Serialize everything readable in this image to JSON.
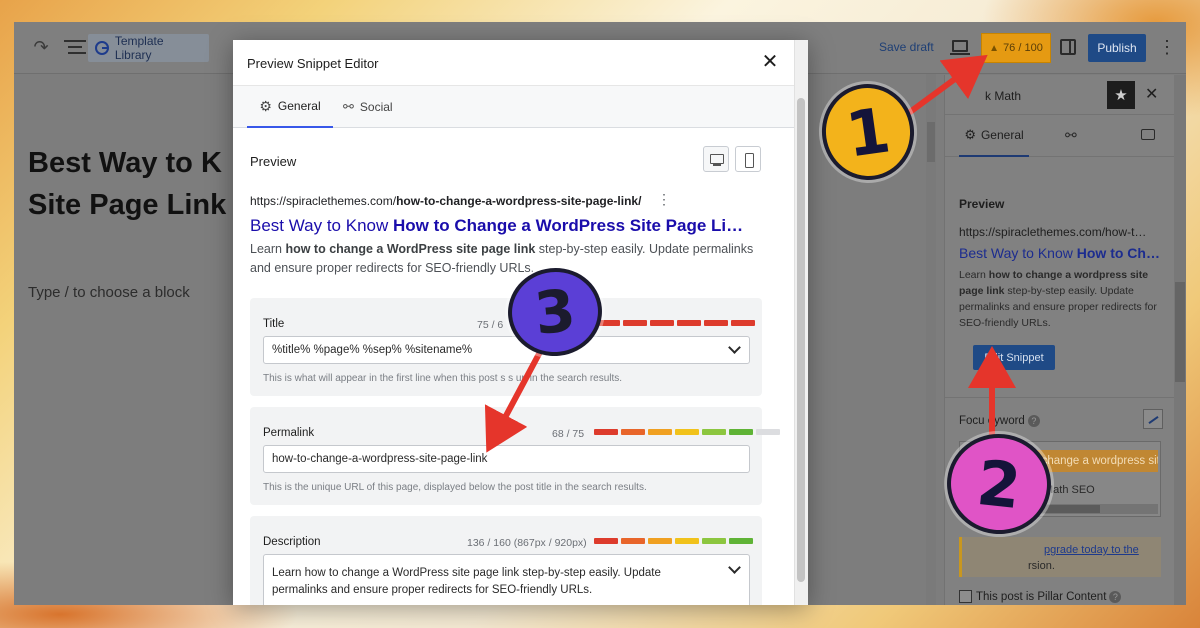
{
  "editor": {
    "template_library": "Template Library",
    "save_draft": "Save draft",
    "score": "76 / 100",
    "publish": "Publish",
    "post_title_lines": [
      "Best Way to K",
      "Site Page Link"
    ],
    "block_hint": "Type / to choose a block"
  },
  "sidebar": {
    "title": "k Math",
    "tab_general": "General",
    "preview_label": "Preview",
    "url": "https://spiraclethemes.com/how-t…",
    "serp_title_plain": "Best Way to Know ",
    "serp_title_bold": "How to Ch…",
    "serp_desc_html_parts": [
      "Learn ",
      "how to change a wordpress site page link",
      " step-by-step easily. Update permalinks and ensure proper redirects for SEO-friendly URLs."
    ],
    "edit_snippet": "Edit Snippet",
    "focus_label": "Focu  eyword",
    "keyword_chip": "o change a wordpress site",
    "keyword_sub": "Math SEO",
    "upgrade_link": "pgrade today to the",
    "upgrade_tail": "rsion.",
    "pillar": "This post is Pillar Content"
  },
  "modal": {
    "title": "Preview Snippet Editor",
    "tabs": {
      "general": "General",
      "social": "Social"
    },
    "preview_label": "Preview",
    "serp": {
      "url_base": "https://spiraclethemes.com/",
      "url_slug": "how-to-change-a-wordpress-site-page-link/",
      "title_plain": "Best Way to Know ",
      "title_bold": "How to Change a WordPress Site Page Li…",
      "desc_lead": "Learn ",
      "desc_bold": "how to change a WordPress site page link",
      "desc_tail": " step-by-step easily. Update permalinks and ensure proper redirects for SEO-friendly URLs."
    },
    "fields": {
      "title": {
        "label": "Title",
        "count": "75 / 6",
        "value": "%title% %page% %sep% %sitename%",
        "help": "This is what will appear in the first line when this post s   s up in the search results."
      },
      "permalink": {
        "label": "Permalink",
        "count": "68 / 75",
        "value": "how-to-change-a-wordpress-site-page-link",
        "help": "This is the unique URL of this page, displayed below the post title in the search results."
      },
      "description": {
        "label": "Description",
        "count": "136 / 160 (867px / 920px)",
        "value": "Learn how to change a WordPress site page link step-by-step easily. Update permalinks and ensure proper redirects for SEO-friendly URLs."
      }
    }
  },
  "meters": {
    "title": [
      "#dd3b2c",
      "#dd3b2c",
      "#dd3b2c",
      "#dd3b2c",
      "#dd3b2c",
      "#dd3b2c"
    ],
    "permalink": [
      "#dd3b2c",
      "#e8652a",
      "#f0a021",
      "#f1c21b",
      "#8cc63f",
      "#5fb336",
      "#dcdde0"
    ],
    "description": [
      "#dd3b2c",
      "#e8652a",
      "#f0a021",
      "#f1c21b",
      "#8cc63f",
      "#5fb336"
    ]
  },
  "annotations": {
    "badge_1": "1",
    "badge_2": "2",
    "badge_3": "3",
    "badge_1_color": "#f3b31b",
    "badge_2_color": "#e054c6",
    "badge_3_color": "#5b3fd6",
    "arrow_color": "#e5352b"
  },
  "icons": {
    "redo": "redo-icon",
    "list_view": "list-view-icon",
    "close": "close-icon",
    "gear": "gear-icon",
    "share": "share-icon",
    "desktop": "desktop-icon",
    "mobile": "mobile-icon",
    "chevron": "chevron-down-icon",
    "star": "star-icon",
    "help": "help-icon"
  }
}
